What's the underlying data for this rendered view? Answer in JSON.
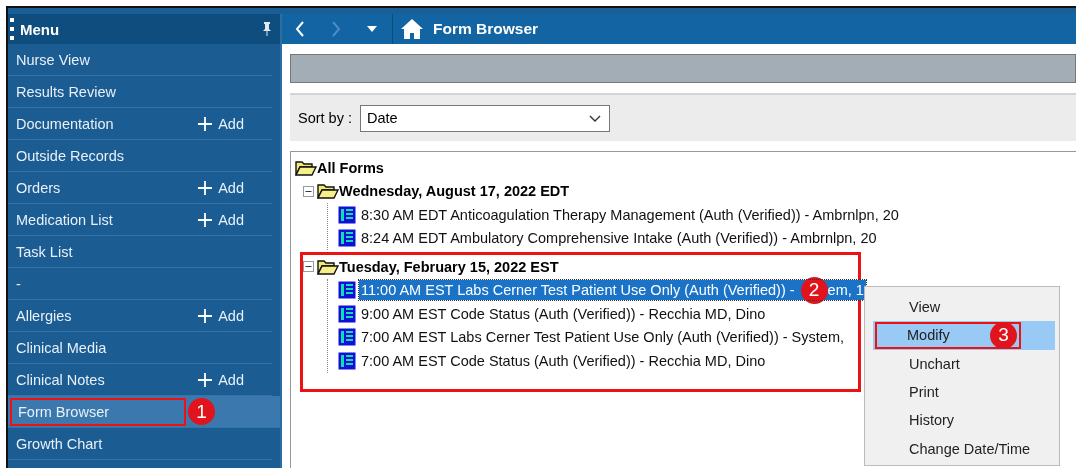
{
  "menu": {
    "title": "Menu",
    "items": [
      {
        "label": "Nurse View",
        "selected": false
      },
      {
        "label": "Results Review",
        "selected": false
      },
      {
        "label": "Documentation",
        "add": "Add",
        "selected": false
      },
      {
        "label": "Outside Records",
        "selected": false
      },
      {
        "label": "Orders",
        "add": "Add",
        "selected": false
      },
      {
        "label": "Medication List",
        "add": "Add",
        "selected": false
      },
      {
        "label": "Task List",
        "selected": false
      },
      {
        "label": "-",
        "selected": false
      },
      {
        "label": "Allergies",
        "add": "Add",
        "selected": false
      },
      {
        "label": "Clinical Media",
        "selected": false
      },
      {
        "label": "Clinical Notes",
        "add": "Add",
        "selected": false
      },
      {
        "label": "Form Browser",
        "selected": true,
        "annotation": "1"
      },
      {
        "label": "Growth Chart",
        "selected": false
      }
    ]
  },
  "toolbar": {
    "title": "Form Browser"
  },
  "sort": {
    "label": "Sort by :",
    "value": "Date"
  },
  "tree": {
    "label": "All Forms",
    "children": [
      {
        "label": "Wednesday, August 17, 2022 EDT",
        "expanded": true,
        "annotation_box": false,
        "children": [
          {
            "text": "8:30 AM EDT Anticoagulation Therapy Management (Auth (Verified)) - Ambrnlpn, 20",
            "selected": false
          },
          {
            "text": "8:24 AM EDT Ambulatory Comprehensive Intake (Auth (Verified)) - Ambrnlpn, 20",
            "selected": false
          }
        ]
      },
      {
        "label": "Tuesday, February 15, 2022 EST",
        "expanded": true,
        "annotation_box": true,
        "children": [
          {
            "text": "11:00 AM EST Labs Cerner Test Patient Use Only (Auth (Verified)) -",
            "annotation": "2",
            "text_after": "em, 1",
            "selected": true
          },
          {
            "text": "9:00 AM EST Code Status (Auth (Verified)) - Recchia MD, Dino",
            "selected": false
          },
          {
            "text": "7:00 AM EST Labs Cerner Test Patient Use Only (Auth (Verified)) - System,",
            "selected": false
          },
          {
            "text": "7:00 AM EST Code Status (Auth (Verified)) - Recchia MD, Dino",
            "selected": false
          }
        ]
      }
    ]
  },
  "context_menu": {
    "items": [
      {
        "label": "View",
        "selected": false
      },
      {
        "label": "Modify",
        "selected": true,
        "annotation": "3"
      },
      {
        "label": "Unchart",
        "selected": false
      },
      {
        "label": "Print",
        "selected": false
      },
      {
        "label": "History",
        "selected": false
      },
      {
        "label": "Change Date/Time",
        "selected": false
      }
    ]
  }
}
